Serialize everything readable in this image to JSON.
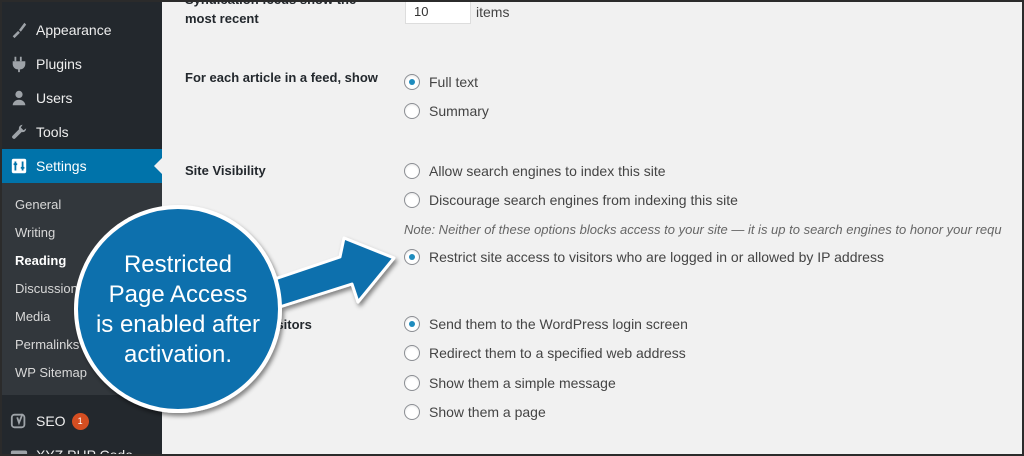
{
  "sidebar": {
    "menu": [
      {
        "label": "Appearance",
        "icon": "paintbrush-icon"
      },
      {
        "label": "Plugins",
        "icon": "plugin-icon"
      },
      {
        "label": "Users",
        "icon": "users-icon"
      },
      {
        "label": "Tools",
        "icon": "wrench-icon"
      },
      {
        "label": "Settings",
        "icon": "settings-icon"
      }
    ],
    "submenu": [
      "General",
      "Writing",
      "Reading",
      "Discussion",
      "Media",
      "Permalinks",
      "WP Sitemap"
    ],
    "seo": {
      "label": "SEO",
      "badge": "1"
    },
    "xyz": {
      "label": "XYZ PHP Code"
    }
  },
  "main": {
    "syndication_label": "Syndication feeds show the most recent",
    "syndication_label_lines": [
      "Syndication feeds show the",
      "most recent"
    ],
    "syndication_value": "10",
    "items_label": "items",
    "feed_label": "For each article in a feed, show",
    "feed_options": [
      "Full text",
      "Summary"
    ],
    "visibility_label": "Site Visibility",
    "visibility_options": [
      "Allow search engines to index this site",
      "Discourage search engines from indexing this site"
    ],
    "visibility_note": "Note: Neither of these options blocks access to your site — it is up to search engines to honor your requ",
    "restrict_option": "Restrict site access to visitors who are logged in or allowed by IP address",
    "handle_label_partial": "d visitors",
    "handle_options": [
      "Send them to the WordPress login screen",
      "Redirect them to a specified web address",
      "Show them a simple message",
      "Show them a page"
    ]
  },
  "callout": {
    "lines": [
      "Restricted",
      "Page Access",
      "is enabled after",
      "activation."
    ],
    "color": "#0f6fad"
  },
  "colors": {
    "sidebar_bg": "#23282d",
    "submenu_bg": "#32373c",
    "active_bg": "#0073aa",
    "content_bg": "#f1f1f1",
    "radio_dot": "#1e8cbe"
  }
}
